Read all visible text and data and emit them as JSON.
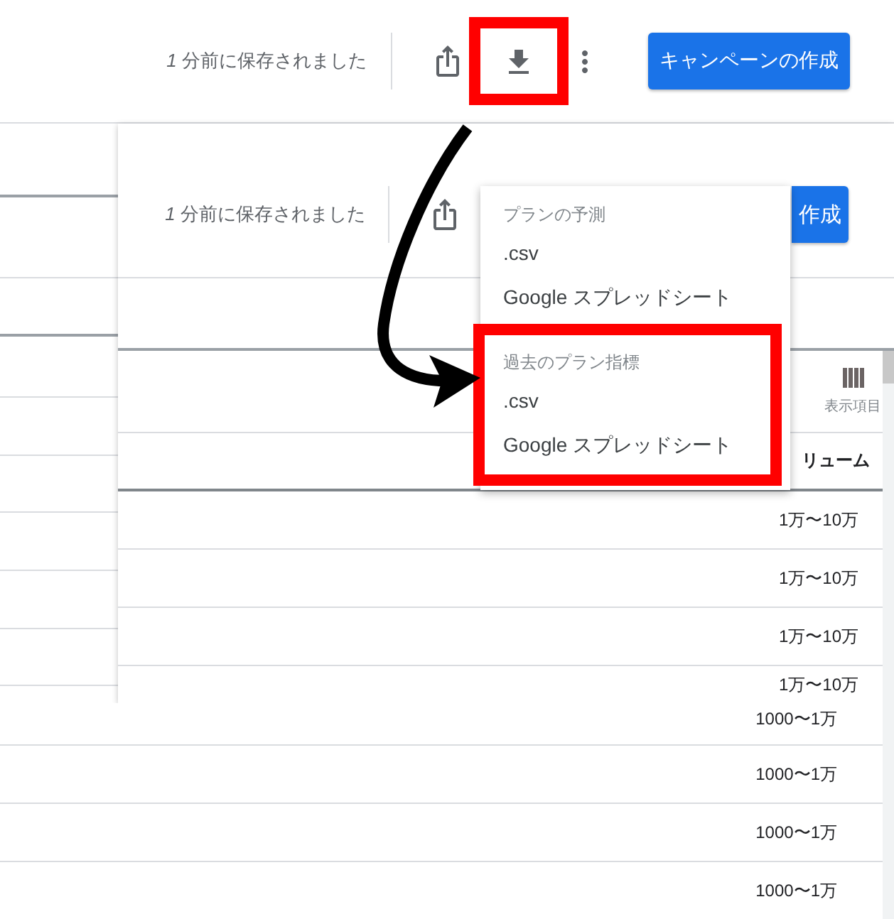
{
  "toolbar": {
    "save_status": "*1* 分前に保存されました",
    "icons": [
      {
        "kind": "share",
        "highlighted": false
      },
      {
        "kind": "download",
        "highlighted": true
      },
      {
        "kind": "more",
        "highlighted": false
      }
    ],
    "button": "キャンペーンの作成"
  },
  "inner_window": {
    "toolbar": {
      "save_status": "*1* 分前に保存されました",
      "button": "作成"
    },
    "export_menu": {
      "sections": [
        {
          "heading": "プランの予測",
          "highlighted": false,
          "items": [
            ".csv",
            "Google スプレッドシート"
          ]
        },
        {
          "heading": "過去のプラン指標",
          "highlighted": true,
          "items": [
            ".csv",
            "Google スプレッドシート"
          ]
        }
      ]
    },
    "table": {
      "column_picker": "表示項目",
      "columns": [
        "リューム"
      ],
      "rows": [
        [
          "1万〜10万"
        ],
        [
          "1万〜10万"
        ],
        [
          "1万〜10万"
        ],
        [
          "1万〜10万"
        ]
      ]
    }
  },
  "lower_table": {
    "rows": [
      [
        "1000〜1万"
      ],
      [
        "1000〜1万"
      ],
      [
        "1000〜1万"
      ],
      [
        "1000〜1万"
      ]
    ]
  }
}
